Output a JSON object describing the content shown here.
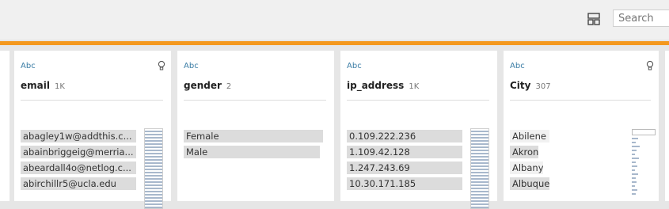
{
  "toolbar": {
    "layout_icon": "grid-layout-icon",
    "search_placeholder": "Search"
  },
  "colors": {
    "accent": "#f4981e",
    "type_label": "#3d7ea6",
    "bar_fill": "#dcdcdc",
    "strip": "#a8b8cc"
  },
  "cards": [
    {
      "type": "Abc",
      "title": "email",
      "count": "1K",
      "bulb": true,
      "values": [
        "abagley1w@addthis.c...",
        "abainbriggeig@merria...",
        "abeardall4o@netlog.c...",
        "abirchillr5@ucla.edu"
      ]
    },
    {
      "type": "Abc",
      "title": "gender",
      "count": "2",
      "bulb": false,
      "values": [
        "Female",
        "Male"
      ]
    },
    {
      "type": "Abc",
      "title": "ip_address",
      "count": "1K",
      "bulb": false,
      "values": [
        "0.109.222.236",
        "1.109.42.128",
        "1.247.243.69",
        "10.30.171.185"
      ]
    },
    {
      "type": "Abc",
      "title": "City",
      "count": "307",
      "bulb": true,
      "values": [
        "Abilene",
        "Akron",
        "Albany",
        "Albuquerque"
      ]
    }
  ]
}
